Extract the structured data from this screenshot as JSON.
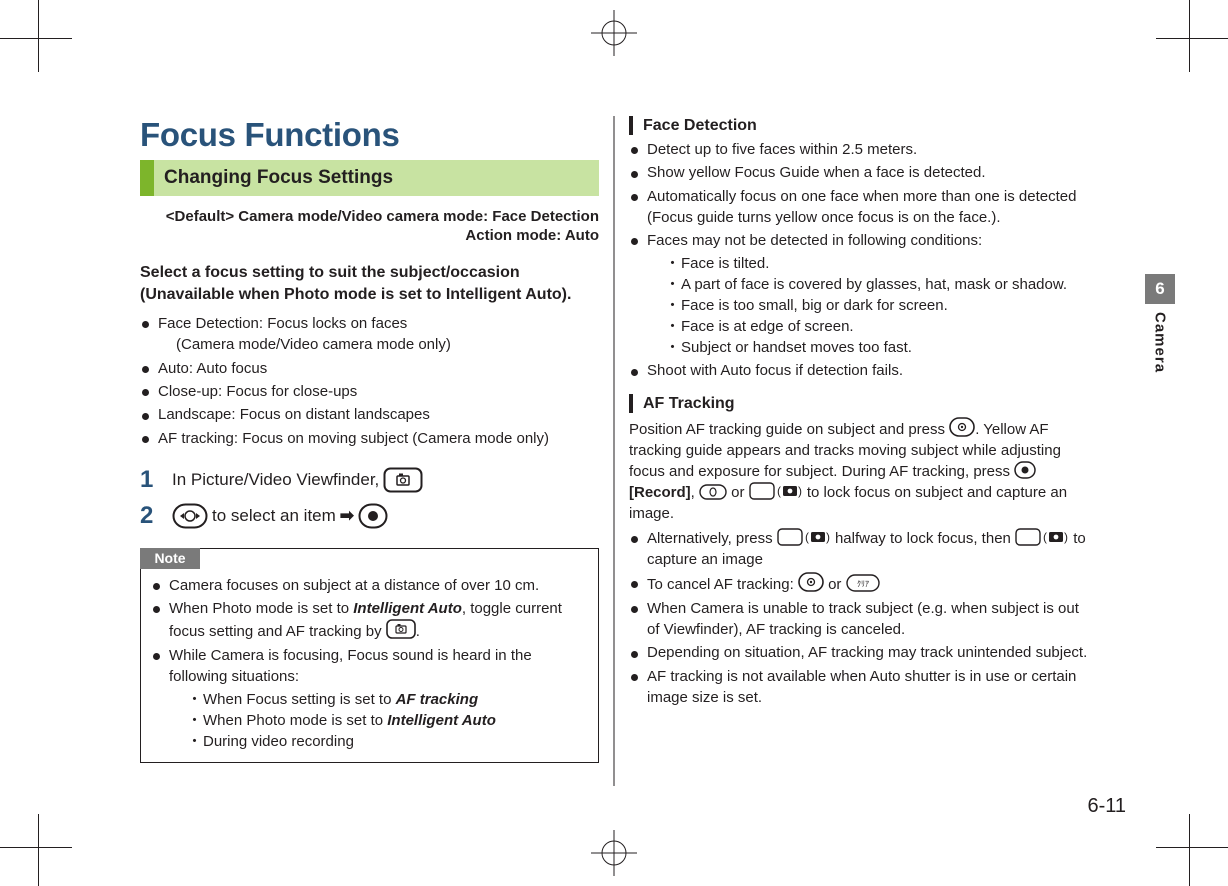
{
  "page": {
    "number": "6-11",
    "chapter_number": "6",
    "chapter_label": "Camera"
  },
  "left": {
    "title": "Focus Functions",
    "section_label": "Changing Focus Settings",
    "default_line": "<Default> Camera mode/Video camera mode: Face Detection",
    "default_sub": "Action mode: Auto",
    "lead": "Select a focus setting to suit the subject/occasion (Unavailable when Photo mode is set to Intelligent Auto).",
    "bullets": [
      {
        "main": "Face Detection: Focus locks on faces",
        "tail": "(Camera mode/Video camera mode only)"
      },
      {
        "main": "Auto: Auto focus"
      },
      {
        "main": "Close-up: Focus for close-ups"
      },
      {
        "main": "Landscape: Focus on distant landscapes"
      },
      {
        "main": "AF tracking: Focus on moving subject (Camera mode only)"
      }
    ],
    "step1_text": "In Picture/Video Viewfinder,",
    "step2_pre": "",
    "step2_mid": "to select an item",
    "step2_arrow": "➡",
    "note_label": "Note",
    "note_items": [
      "Camera focuses on subject at a distance of over 10 cm.",
      "When Photo mode is set to ",
      "While Camera is focusing, Focus sound is heard in the following situations:"
    ],
    "note_ia": "Intelligent Auto",
    "note_ia_tail": ", toggle current focus setting and AF tracking by ",
    "note_subs": [
      "When Focus setting is set to ",
      "When Photo mode is set to ",
      "During video recording"
    ],
    "note_af": "AF tracking",
    "note_ia2": "Intelligent Auto"
  },
  "right": {
    "face_heading": "Face Detection",
    "face_bullets": [
      "Detect up to five faces within 2.5 meters.",
      "Show yellow Focus Guide when a face is detected.",
      "Automatically focus on one face when more than one is detected (Focus guide turns yellow once focus is on the face.).",
      "Faces may not be detected in following conditions:"
    ],
    "face_subs": [
      "Face is tilted.",
      "A part of face is covered by glasses, hat, mask or shadow.",
      "Face is too small, big or dark for screen.",
      "Face is at edge of screen.",
      "Subject or handset moves too fast."
    ],
    "face_last": "Shoot with Auto focus if detection fails.",
    "af_heading": "AF Tracking",
    "af_para1_a": "Position AF tracking guide on subject and press ",
    "af_para1_b": ". Yellow AF tracking guide appears and tracks moving subject while adjusting focus and exposure for subject. During AF tracking, press ",
    "af_record": "[Record]",
    "af_para1_c": ", ",
    "af_para1_d": " or ",
    "af_para1_e": " to lock focus on subject and capture an image.",
    "af_bullets_a": "Alternatively, press ",
    "af_bullets_a2": " halfway to lock focus, then ",
    "af_bullets_a3": " to capture an image",
    "af_bullets_b": "To cancel AF tracking: ",
    "af_bullets_b2": " or ",
    "af_bullets_c": "When Camera is unable to track subject (e.g. when subject is out of Viewfinder), AF tracking is canceled.",
    "af_bullets_d": "Depending on situation, AF tracking may track unintended subject.",
    "af_bullets_e": "AF tracking is not available when Auto shutter is in use or certain image size is set."
  }
}
